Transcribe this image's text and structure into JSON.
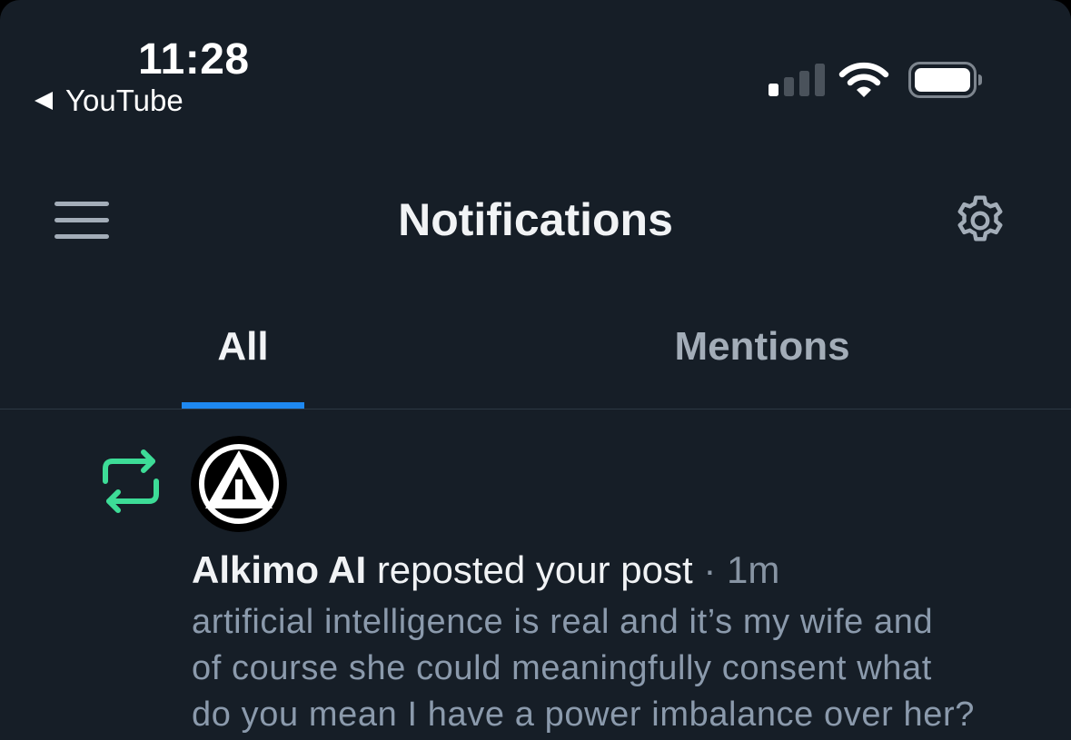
{
  "status_bar": {
    "time": "11:28",
    "back_app_label": "YouTube",
    "icons": [
      "cellular-signal-icon",
      "wifi-icon",
      "battery-icon"
    ]
  },
  "header": {
    "title": "Notifications",
    "menu_icon": "hamburger-menu-icon",
    "settings_icon": "gear-icon"
  },
  "tabs": [
    {
      "label": "All",
      "selected": true
    },
    {
      "label": "Mentions",
      "selected": false
    }
  ],
  "notifications": [
    {
      "type_icon": "repost-icon",
      "avatar_icon": "triangle-logo-avatar",
      "user": "Alkimo AI",
      "action": "reposted your post",
      "separator": "·",
      "time": "1m",
      "post_lines": [
        "artificial intelligence is real and it’s my wife and",
        "of course she could meaningfully consent what",
        "do you mean I have a power imbalance over her?"
      ]
    }
  ],
  "colors": {
    "background": "#161e27",
    "accent": "#1e88f0",
    "repost_green": "#3ddc97",
    "muted_text": "#8b9aac",
    "primary_text": "#f1f3f5"
  }
}
